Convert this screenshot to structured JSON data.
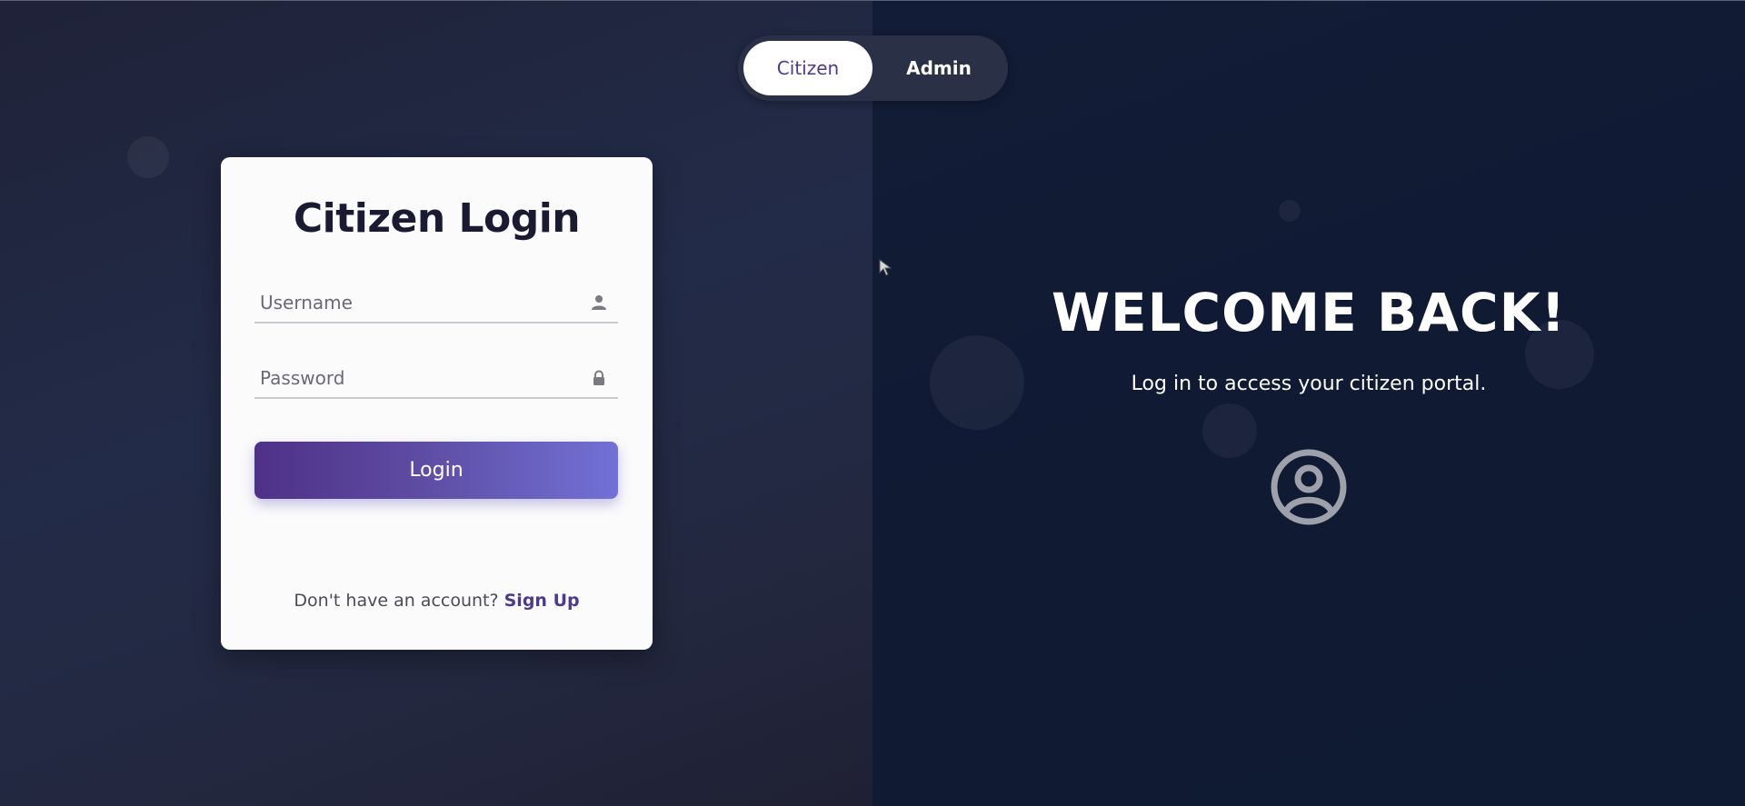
{
  "toggle": {
    "citizen_label": "Citizen",
    "admin_label": "Admin",
    "active": "Citizen"
  },
  "login_card": {
    "title": "Citizen Login",
    "username_placeholder": "Username",
    "username_value": "",
    "password_placeholder": "Password",
    "password_value": "",
    "login_label": "Login",
    "signup_prompt": "Don't have an account?",
    "signup_link": "Sign Up"
  },
  "welcome_panel": {
    "heading": "WELCOME BACK!",
    "subtitle": "Log in to access your citizen portal."
  },
  "icons": {
    "username": "user-icon",
    "password": "lock-icon",
    "welcome": "user-circle-icon"
  },
  "colors": {
    "accent": "#4e3a8c",
    "button_gradient_start": "#4f3088",
    "button_gradient_end": "#7271d6",
    "card_bg": "#fbfbfc",
    "title_color": "#1b1a33"
  }
}
